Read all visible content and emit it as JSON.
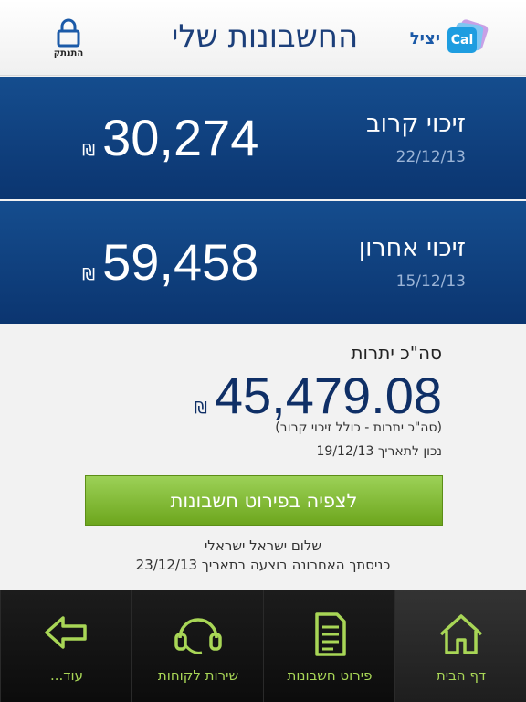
{
  "header": {
    "title": "החשבונות שלי",
    "logout_label": "התנתק",
    "brand_text": "יציל",
    "brand_logo_text": "Cal"
  },
  "credits": [
    {
      "title": "זיכוי קרוב",
      "date": "22/12/13",
      "amount": "30,274",
      "currency": "₪"
    },
    {
      "title": "זיכוי אחרון",
      "date": "15/12/13",
      "amount": "59,458",
      "currency": "₪"
    }
  ],
  "summary": {
    "label": "סה\"כ יתרות",
    "amount": "45,479.08",
    "currency": "₪",
    "note": "(סה\"כ יתרות - כולל זיכוי קרוב)",
    "as_of": "נכון לתאריך 19/12/13",
    "details_button": "לצפיה בפירוט חשבונות",
    "greeting": "שלום ישראל ישראלי",
    "last_login": "כניסתך האחרונה בוצעה בתאריך 23/12/13"
  },
  "tabs": [
    {
      "label": "עוד...",
      "icon": "arrow-left-icon"
    },
    {
      "label": "שירות לקוחות",
      "icon": "headset-icon"
    },
    {
      "label": "פירוט חשבונות",
      "icon": "document-icon"
    },
    {
      "label": "דף הבית",
      "icon": "home-icon",
      "active": true
    }
  ],
  "colors": {
    "header_title": "#1c3f7a",
    "panel_blue": "#0b3570",
    "accent_green": "#8cc63f",
    "tab_label": "#a8d656"
  }
}
